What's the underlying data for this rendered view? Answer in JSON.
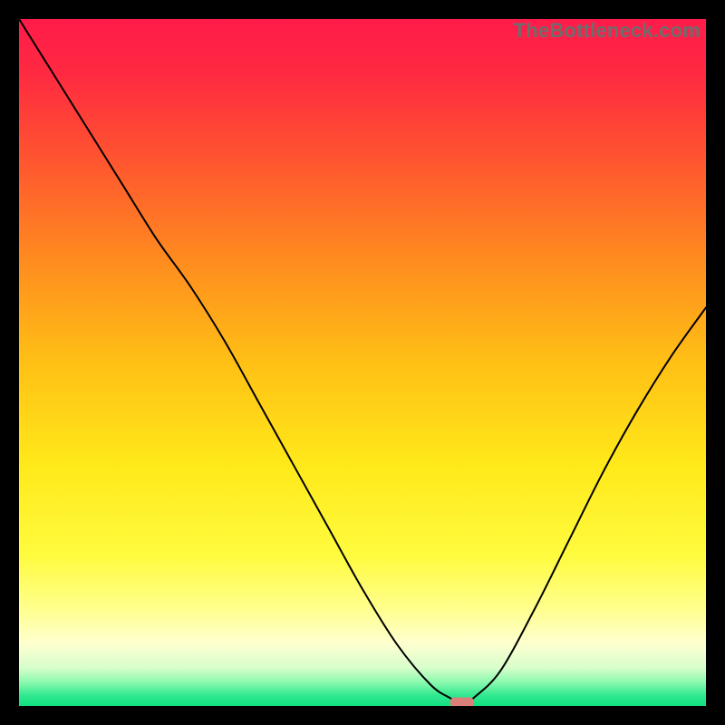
{
  "watermark": "TheBottleneck.com",
  "chart_data": {
    "type": "line",
    "title": "",
    "xlabel": "",
    "ylabel": "",
    "xlim": [
      0,
      100
    ],
    "ylim": [
      0,
      100
    ],
    "x": [
      0,
      5,
      10,
      15,
      20,
      25,
      30,
      35,
      40,
      45,
      50,
      55,
      60,
      63,
      64,
      65,
      66,
      70,
      75,
      80,
      85,
      90,
      95,
      100
    ],
    "values": [
      100,
      92,
      84,
      76,
      68,
      61,
      53,
      44,
      35,
      26,
      17,
      9,
      3,
      1,
      0,
      0,
      1,
      5,
      14,
      24,
      34,
      43,
      51,
      58
    ],
    "grid": false,
    "legend": false,
    "marker": {
      "x": 64.5,
      "y": 0.5,
      "width": 3.5,
      "height_pct": 1.5,
      "color": "#db7f7b"
    },
    "background_gradient": {
      "stops": [
        {
          "offset": 0.0,
          "color": "#ff1b4a"
        },
        {
          "offset": 0.08,
          "color": "#ff2a41"
        },
        {
          "offset": 0.2,
          "color": "#ff5330"
        },
        {
          "offset": 0.35,
          "color": "#ff8b1f"
        },
        {
          "offset": 0.5,
          "color": "#ffc015"
        },
        {
          "offset": 0.65,
          "color": "#ffe91a"
        },
        {
          "offset": 0.78,
          "color": "#fffb3e"
        },
        {
          "offset": 0.86,
          "color": "#ffff8f"
        },
        {
          "offset": 0.91,
          "color": "#feffd0"
        },
        {
          "offset": 0.945,
          "color": "#d6fecb"
        },
        {
          "offset": 0.965,
          "color": "#8df9af"
        },
        {
          "offset": 0.985,
          "color": "#2fe98f"
        },
        {
          "offset": 1.0,
          "color": "#11df80"
        }
      ]
    },
    "line_color": "#000000",
    "line_width": 2
  }
}
